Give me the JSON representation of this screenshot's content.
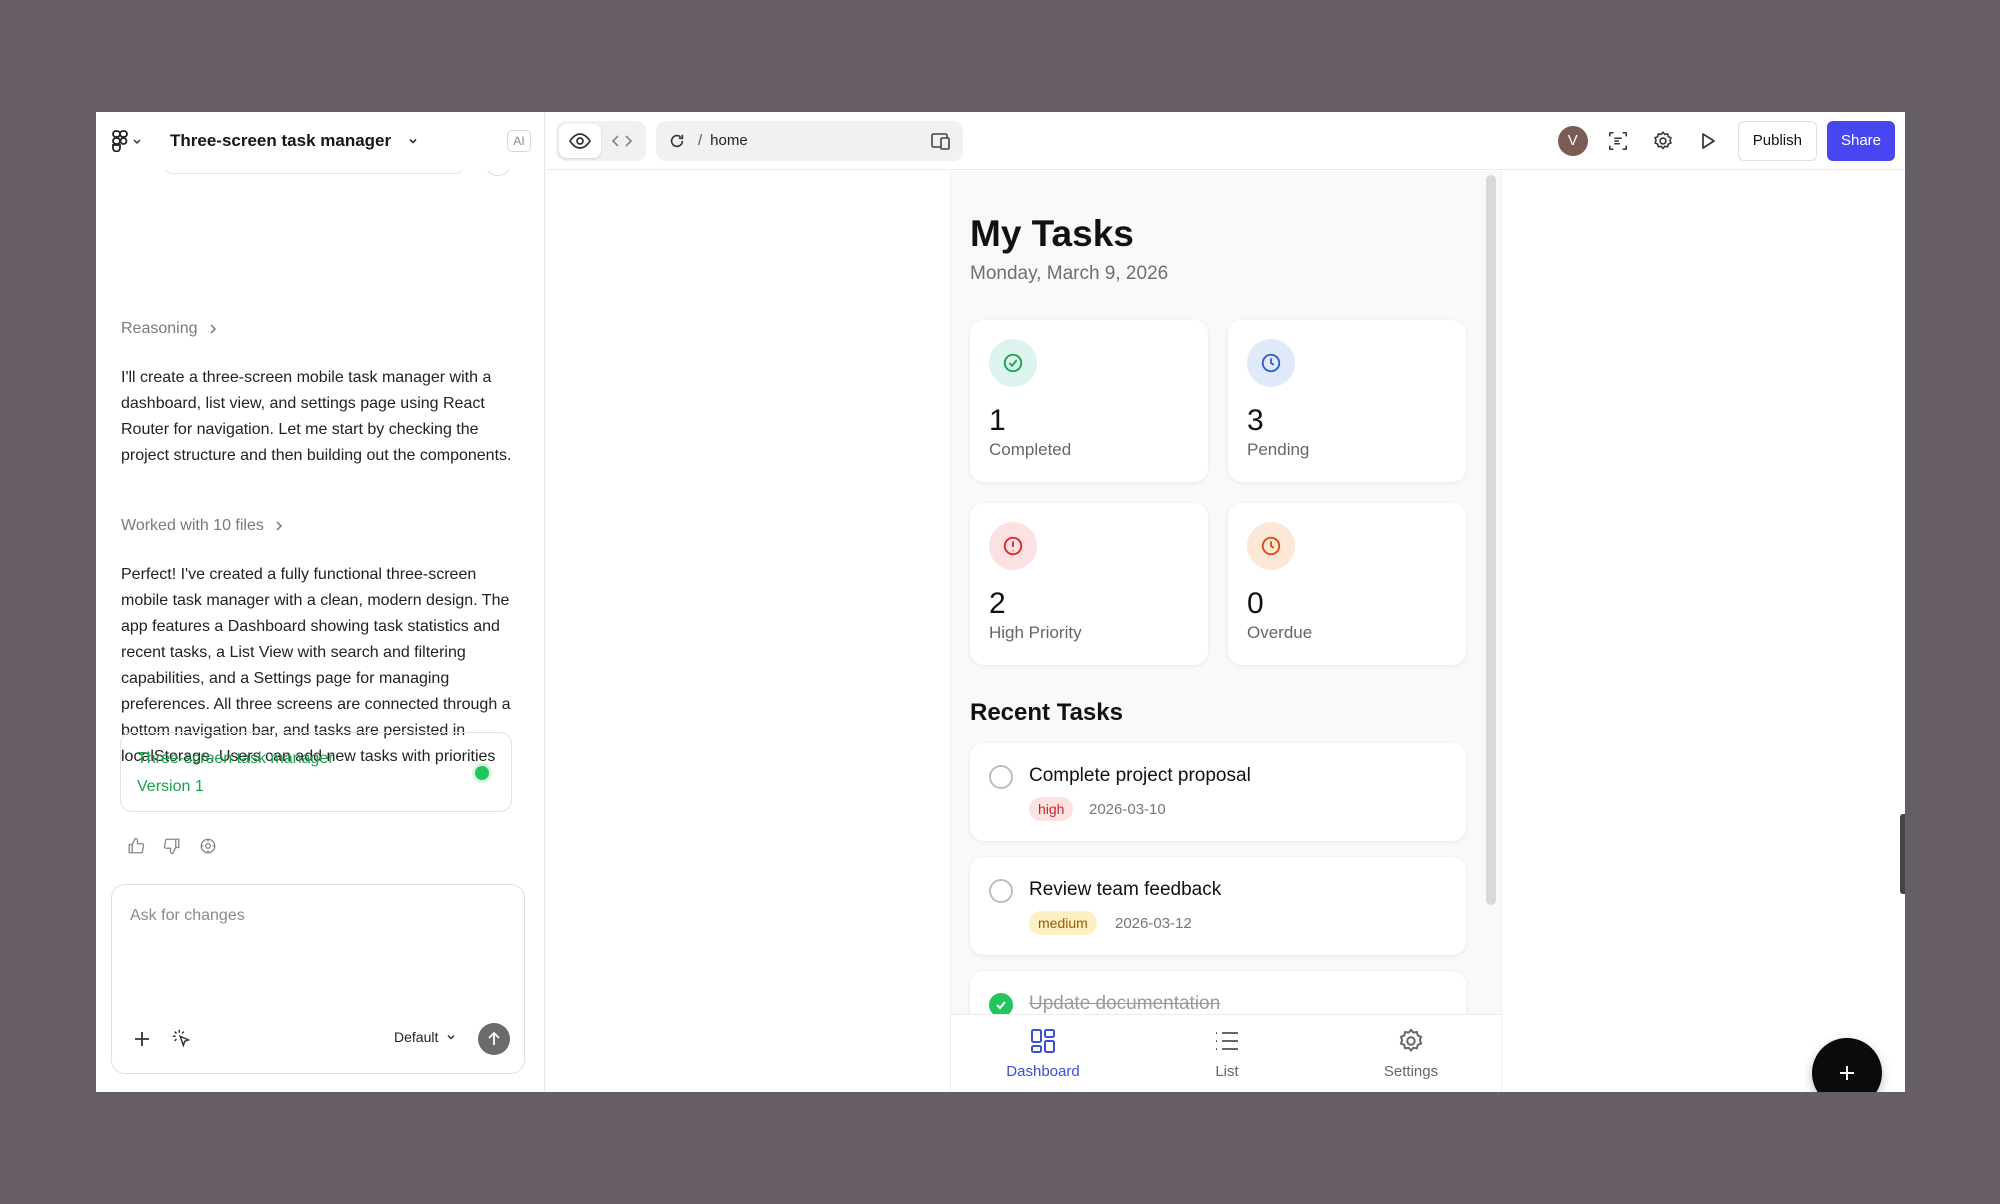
{
  "project": {
    "title": "Three-screen task manager",
    "ai_badge": "AI"
  },
  "chat": {
    "reasoning_label": "Reasoning",
    "message_1": "I'll create a three-screen mobile task manager with a dashboard, list view, and settings page using React Router for navigation. Let me start by checking the project structure and then building out the components.",
    "files_label": "Worked with 10 files",
    "message_2": "Perfect! I've created a fully functional three-screen mobile task manager with a clean, modern design. The app features a Dashboard showing task statistics and recent tasks, a List View with search and filtering capabilities, and a Settings page for managing preferences. All three screens are connected through a bottom navigation bar, and tasks are persisted in localStorage. Users can add new tasks with priorities and due dates, mark them complete, delete them, and filter by status.",
    "version_card": {
      "title": "Three-screen task manager",
      "version": "Version 1"
    },
    "composer": {
      "placeholder": "Ask for changes",
      "model": "Default"
    }
  },
  "toolbar": {
    "url_slash": "/",
    "url_path": "home",
    "avatar_initial": "V",
    "publish_label": "Publish",
    "share_label": "Share"
  },
  "app": {
    "title": "My Tasks",
    "date": "Monday, March 9, 2026",
    "stats": [
      {
        "value": "1",
        "label": "Completed",
        "icon": "check-circle-icon",
        "color": "#16a34a",
        "bg": "#dcf3ef"
      },
      {
        "value": "3",
        "label": "Pending",
        "icon": "clock-icon",
        "color": "#2f5bd6",
        "bg": "#dfe9f8"
      },
      {
        "value": "2",
        "label": "High Priority",
        "icon": "alert-circle-icon",
        "color": "#dc2626",
        "bg": "#fbe1e1"
      },
      {
        "value": "0",
        "label": "Overdue",
        "icon": "clock-icon",
        "color": "#dc4a14",
        "bg": "#fde7d7"
      }
    ],
    "recent_title": "Recent Tasks",
    "tasks": [
      {
        "title": "Complete project proposal",
        "priority": "high",
        "due": "2026-03-10",
        "done": false
      },
      {
        "title": "Review team feedback",
        "priority": "medium",
        "due": "2026-03-12",
        "done": false
      },
      {
        "title": "Update documentation",
        "priority": "",
        "due": "",
        "done": true
      }
    ],
    "nav": [
      {
        "label": "Dashboard",
        "icon": "dashboard-icon",
        "active": true
      },
      {
        "label": "List",
        "icon": "list-icon",
        "active": false
      },
      {
        "label": "Settings",
        "icon": "gear-icon",
        "active": false
      }
    ],
    "help_label": "?"
  }
}
